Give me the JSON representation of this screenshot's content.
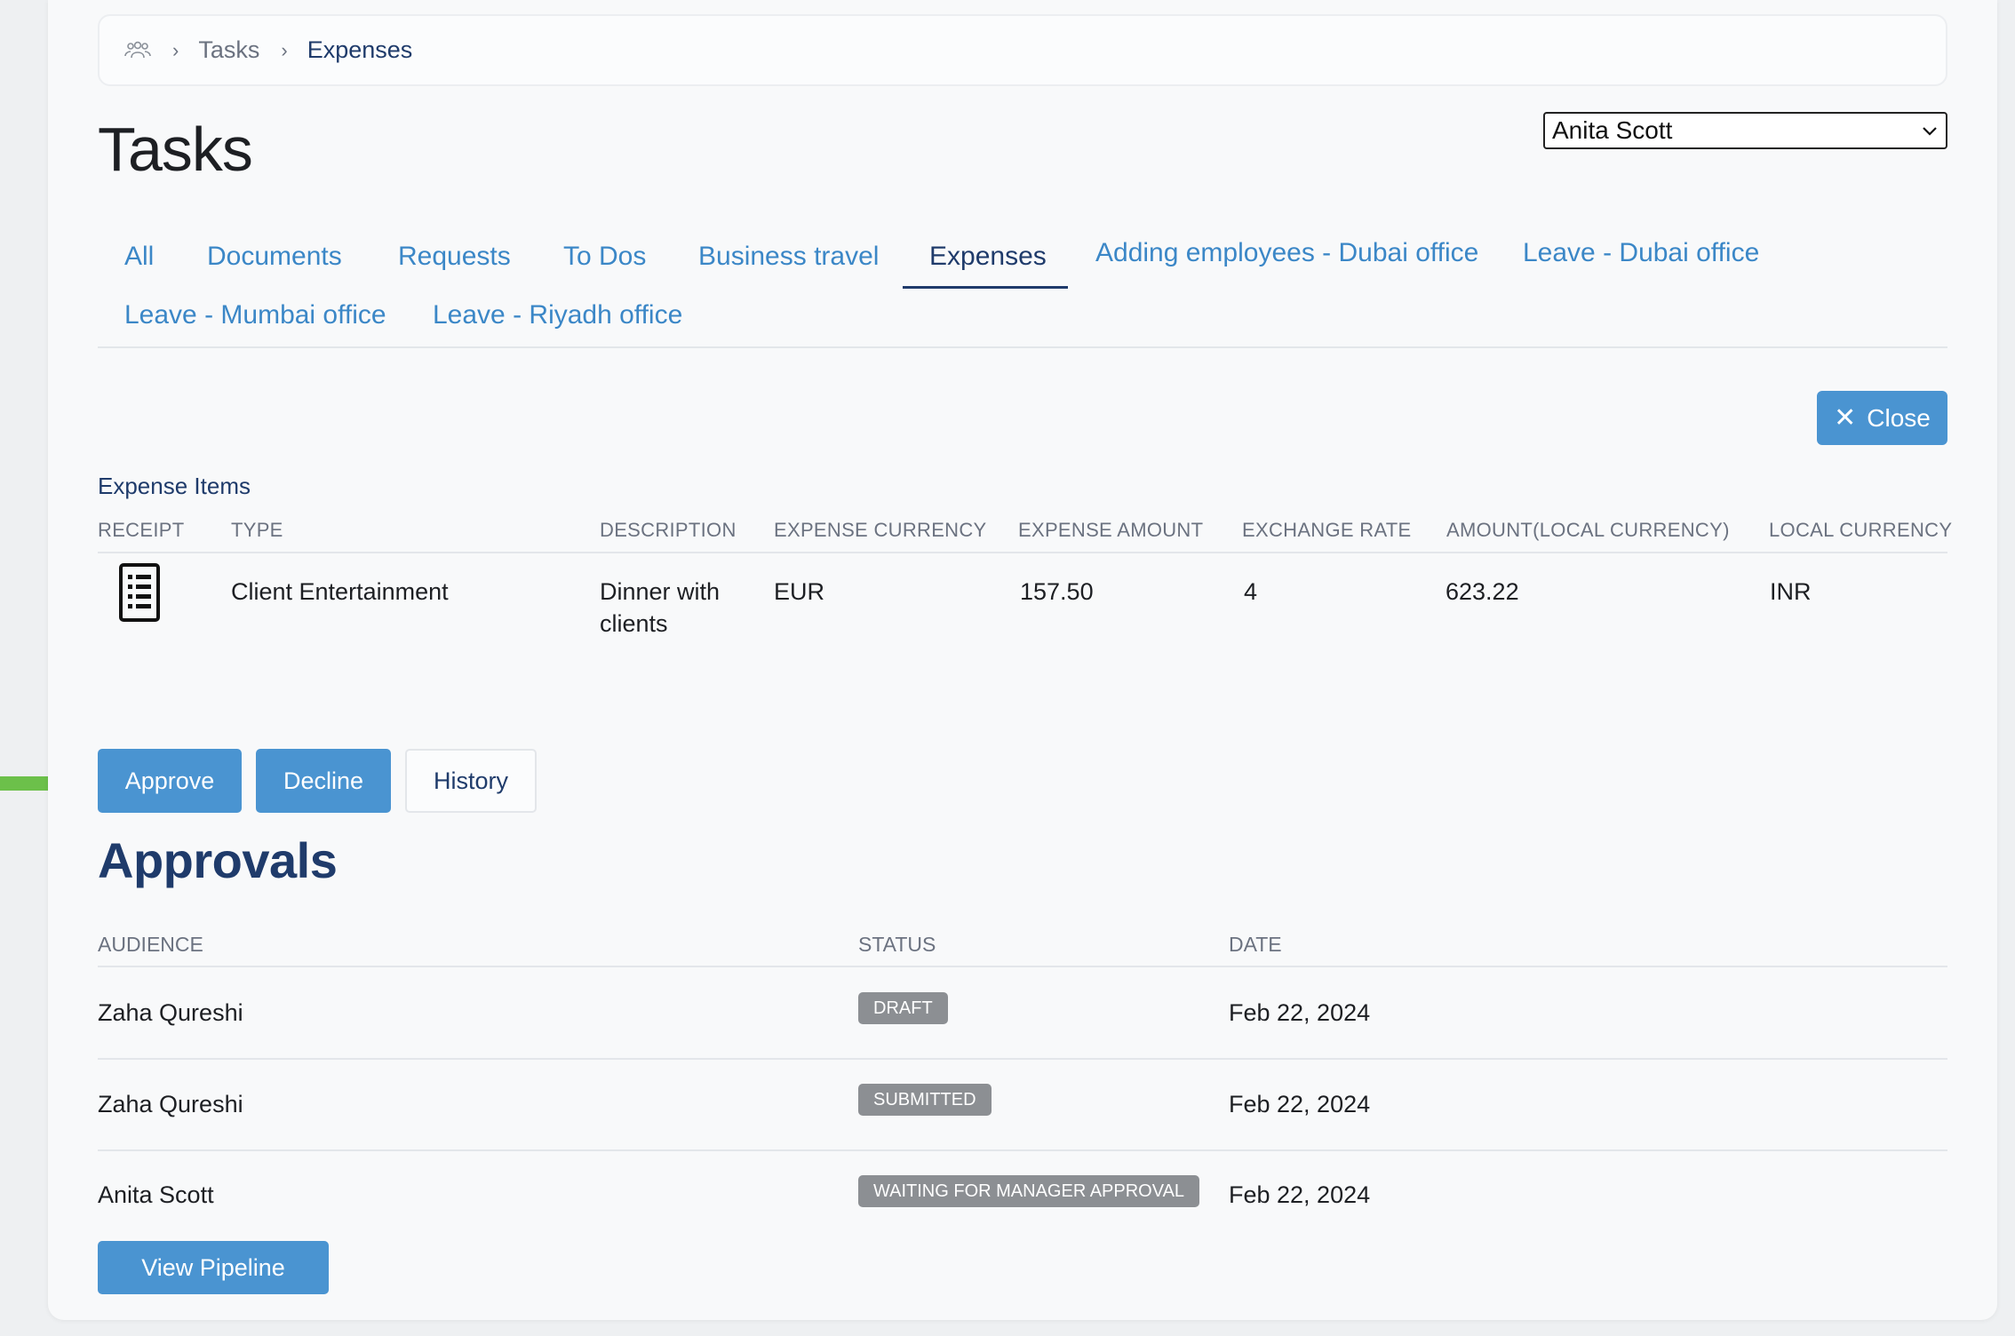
{
  "breadcrumb": {
    "items": [
      "Tasks",
      "Expenses"
    ]
  },
  "page": {
    "title": "Tasks"
  },
  "user_select": {
    "value": "Anita Scott"
  },
  "tabs": [
    {
      "label": "All",
      "active": false
    },
    {
      "label": "Documents",
      "active": false
    },
    {
      "label": "Requests",
      "active": false
    },
    {
      "label": "To Dos",
      "active": false
    },
    {
      "label": "Business travel",
      "active": false
    },
    {
      "label": "Expenses",
      "active": true
    },
    {
      "label": "Adding employees - Dubai office",
      "active": false
    },
    {
      "label": "Leave - Dubai office",
      "active": false
    },
    {
      "label": "Leave - Mumbai office",
      "active": false
    },
    {
      "label": "Leave - Riyadh office",
      "active": false
    }
  ],
  "close_button": {
    "label": "Close"
  },
  "expense_items": {
    "title": "Expense Items",
    "columns": [
      "RECEIPT",
      "TYPE",
      "DESCRIPTION",
      "EXPENSE CURRENCY",
      "EXPENSE AMOUNT",
      "EXCHANGE RATE",
      "AMOUNT(LOCAL CURRENCY)",
      "LOCAL CURRENCY"
    ],
    "rows": [
      {
        "type": "Client Entertainment",
        "description": "Dinner with clients",
        "expense_currency": "EUR",
        "expense_amount": "157.50",
        "exchange_rate": "4",
        "amount_local": "623.22",
        "local_currency": "INR"
      }
    ]
  },
  "actions": {
    "approve": "Approve",
    "decline": "Decline",
    "history": "History"
  },
  "approvals": {
    "title": "Approvals",
    "columns": [
      "AUDIENCE",
      "STATUS",
      "DATE"
    ],
    "rows": [
      {
        "audience": "Zaha Qureshi",
        "status": "DRAFT",
        "date": "Feb 22, 2024"
      },
      {
        "audience": "Zaha Qureshi",
        "status": "SUBMITTED",
        "date": "Feb 22, 2024"
      },
      {
        "audience": "Anita Scott",
        "status": "WAITING FOR MANAGER APPROVAL",
        "date": "Feb 22, 2024"
      }
    ]
  },
  "pipeline_button": {
    "label": "View Pipeline"
  },
  "colors": {
    "accent": "#4a94d1",
    "link": "#3b87c7",
    "navy": "#1f3b6b",
    "badge": "#8c8f93",
    "arrow": "#6cc04a"
  }
}
